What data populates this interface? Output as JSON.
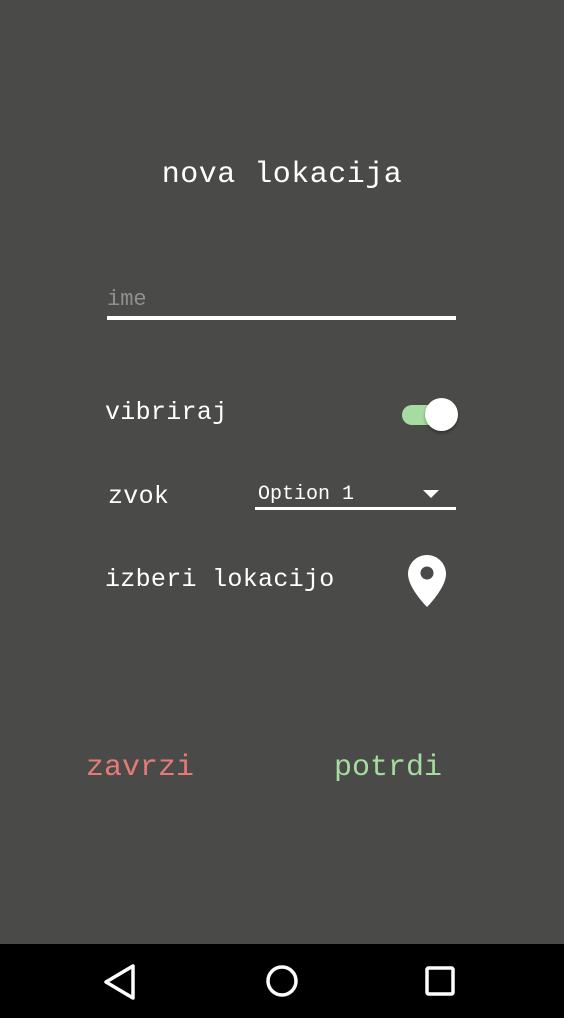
{
  "title": "nova lokacija",
  "name_field": {
    "placeholder": "ime",
    "value": ""
  },
  "vibrate": {
    "label": "vibriraj",
    "enabled": true
  },
  "sound": {
    "label": "zvok",
    "selected": "Option 1"
  },
  "location": {
    "label": "izberi lokacijo",
    "icon": "location-pin-icon"
  },
  "actions": {
    "cancel_label": "zavrzi",
    "confirm_label": "potrdi"
  },
  "navbar": {
    "back_icon": "back-triangle-icon",
    "home_icon": "home-circle-icon",
    "recent_icon": "recents-square-icon"
  },
  "colors": {
    "background": "#4a4b49",
    "cancel": "#e57b76",
    "confirm": "#a7dba1",
    "switch_track": "#a6dca0"
  }
}
